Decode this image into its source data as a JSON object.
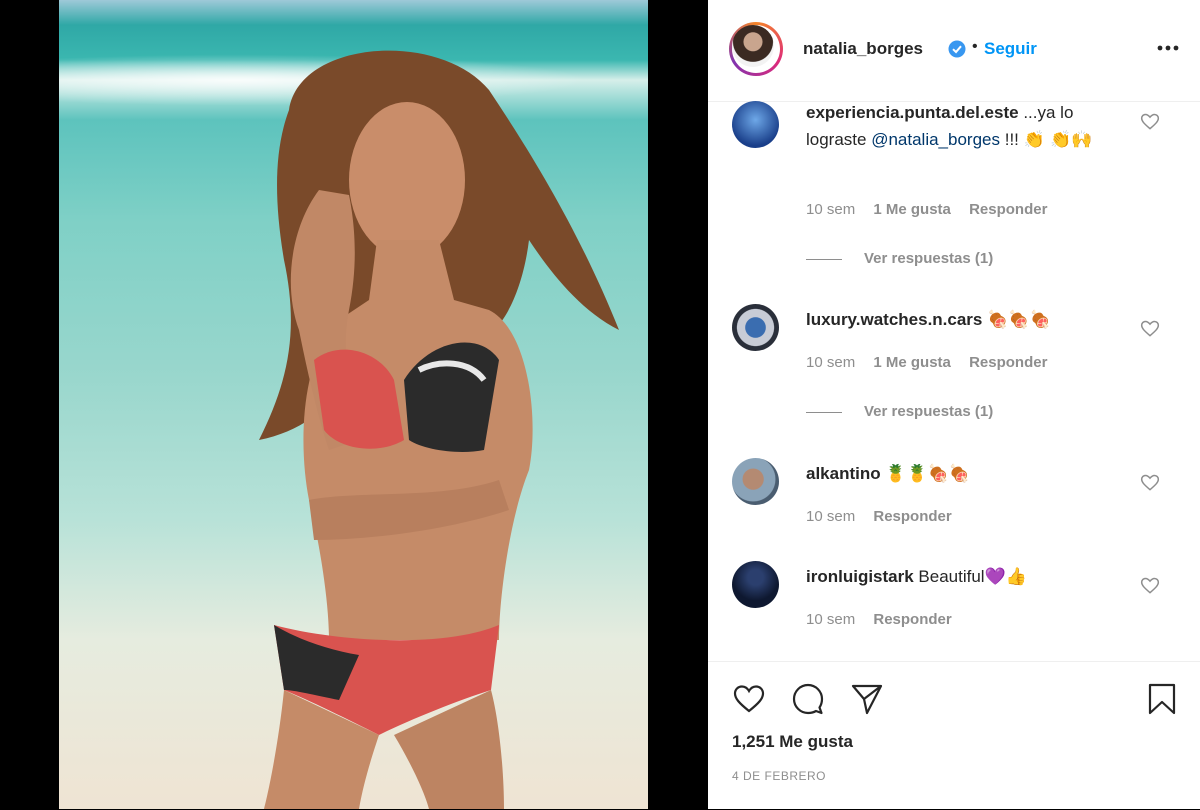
{
  "header": {
    "username": "natalia_borges",
    "separator": "•",
    "follow_label": "Seguir"
  },
  "comments": [
    {
      "username": "experiencia.punta.del.este",
      "text_before": " ...ya lo lograste ",
      "mention": "@natalia_borges",
      "text_after": " !!! ",
      "emoji": "👏 👏🙌",
      "time": "10 sem",
      "likes": "1 Me gusta",
      "reply": "Responder",
      "view_replies": "Ver respuestas (1)"
    },
    {
      "username": "luxury.watches.n.cars",
      "text": " ",
      "emoji": "🍖🍖🍖",
      "time": "10 sem",
      "likes": "1 Me gusta",
      "reply": "Responder",
      "view_replies": "Ver respuestas (1)"
    },
    {
      "username": "alkantino",
      "text": " ",
      "emoji": "🍍🍍🍖🍖",
      "time": "10 sem",
      "reply": "Responder"
    },
    {
      "username": "ironluigistark",
      "text": " Beautiful",
      "emoji": "💜👍",
      "time": "10 sem",
      "reply": "Responder"
    }
  ],
  "footer": {
    "likes_label": "1,251 Me gusta",
    "date": "4 DE FEBRERO"
  },
  "colors": {
    "link_blue": "#0095f6",
    "text_dark": "#262626",
    "text_gray": "#8e8e8e",
    "mention": "#00376b"
  }
}
